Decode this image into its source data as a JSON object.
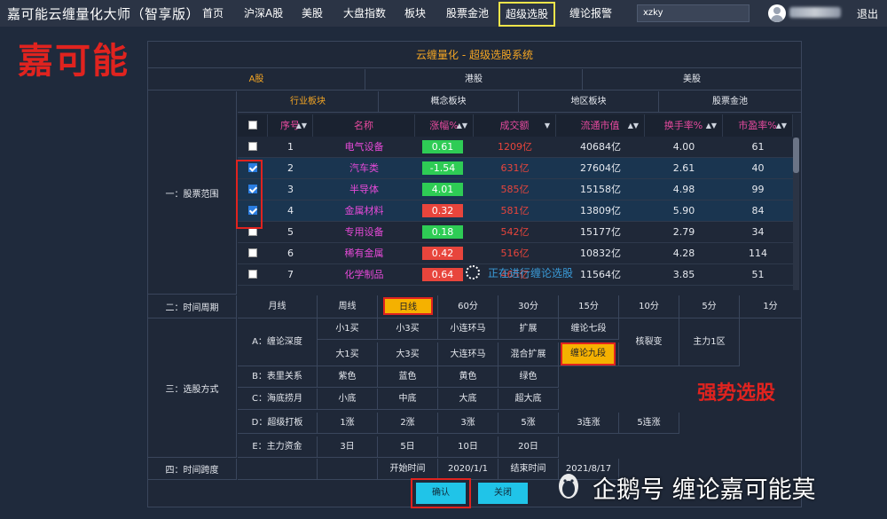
{
  "header": {
    "app_title": "嘉可能云缠量化大师（智享版）",
    "nav": [
      "首页",
      "沪深A股",
      "美股",
      "大盘指数",
      "板块",
      "股票金池",
      "超级选股",
      "缠论报警"
    ],
    "active_nav": "超级选股",
    "search_value": "xzky",
    "logout": "退出"
  },
  "watermarks": {
    "top_left": "嘉可能",
    "right": "强势选股",
    "bottom": "企鹅号 缠论嘉可能莫"
  },
  "panel": {
    "title": "云缠量化 - 超级选股系统",
    "market_tabs": [
      "A股",
      "港股",
      "美股"
    ],
    "sector_tabs": [
      "行业板块",
      "概念板块",
      "地区板块",
      "股票金池"
    ]
  },
  "sections": {
    "range": "一：股票范围",
    "period": "二：时间周期",
    "method": "三：选股方式",
    "span": "四：时间跨度"
  },
  "table": {
    "headers": [
      "序号",
      "名称",
      "涨幅%",
      "成交额",
      "流通市值",
      "换手率%",
      "市盈率%"
    ],
    "rows": [
      {
        "no": "1",
        "name": "电气设备",
        "pct": "0.61",
        "amount": "1209亿",
        "cap": "40684亿",
        "turnover": "4.00",
        "pe": "61",
        "checked": false,
        "dir": "up"
      },
      {
        "no": "2",
        "name": "汽车类",
        "pct": "-1.54",
        "amount": "631亿",
        "cap": "27604亿",
        "turnover": "2.61",
        "pe": "40",
        "checked": true,
        "dir": "up"
      },
      {
        "no": "3",
        "name": "半导体",
        "pct": "4.01",
        "amount": "585亿",
        "cap": "15158亿",
        "turnover": "4.98",
        "pe": "99",
        "checked": true,
        "dir": "up"
      },
      {
        "no": "4",
        "name": "金属材料",
        "pct": "0.32",
        "amount": "581亿",
        "cap": "13809亿",
        "turnover": "5.90",
        "pe": "84",
        "checked": true,
        "dir": "down"
      },
      {
        "no": "5",
        "name": "专用设备",
        "pct": "0.18",
        "amount": "542亿",
        "cap": "15177亿",
        "turnover": "2.79",
        "pe": "34",
        "checked": false,
        "dir": "up"
      },
      {
        "no": "6",
        "name": "稀有金属",
        "pct": "0.42",
        "amount": "516亿",
        "cap": "10832亿",
        "turnover": "4.28",
        "pe": "114",
        "checked": false,
        "dir": "down"
      },
      {
        "no": "7",
        "name": "化学制品",
        "pct": "0.64",
        "amount": "465亿",
        "cap": "11564亿",
        "turnover": "3.85",
        "pe": "51",
        "checked": false,
        "dir": "down"
      }
    ],
    "loading_text": "正在进行缠论选股"
  },
  "periods": [
    "月线",
    "周线",
    "日线",
    "60分",
    "30分",
    "15分",
    "10分",
    "5分",
    "1分"
  ],
  "selected_period": "日线",
  "methods": {
    "a_label": "A：缠论深度",
    "a_row1": [
      "小1买",
      "小3买",
      "小连环马",
      "扩展",
      "缠论七段"
    ],
    "a_row2": [
      "大1买",
      "大3买",
      "大连环马",
      "混合扩展",
      "缠论九段"
    ],
    "a_extra": [
      "核裂变",
      "主力1区"
    ],
    "b_label": "B：表里关系",
    "b_items": [
      "紫色",
      "蓝色",
      "黄色",
      "绿色"
    ],
    "c_label": "C：海底捞月",
    "c_items": [
      "小底",
      "中底",
      "大底",
      "超大底"
    ],
    "d_label": "D：超级打板",
    "d_items": [
      "1涨",
      "2涨",
      "3涨",
      "5涨",
      "3连涨",
      "5连涨"
    ],
    "e_label": "E：主力资金",
    "e_items": [
      "3日",
      "5日",
      "10日",
      "20日"
    ]
  },
  "span": {
    "start_label": "开始时间",
    "start": "2020/1/1",
    "end_label": "结束时间",
    "end": "2021/8/17"
  },
  "buttons": {
    "confirm": "确认",
    "close": "关闭"
  },
  "colors": {
    "gold": "#f5a623",
    "up_green": "#2ecc55",
    "down_red": "#e8453c",
    "name_pink": "#e64ad8",
    "highlight": "#f5b100",
    "button_cyan": "#20c4e8"
  }
}
